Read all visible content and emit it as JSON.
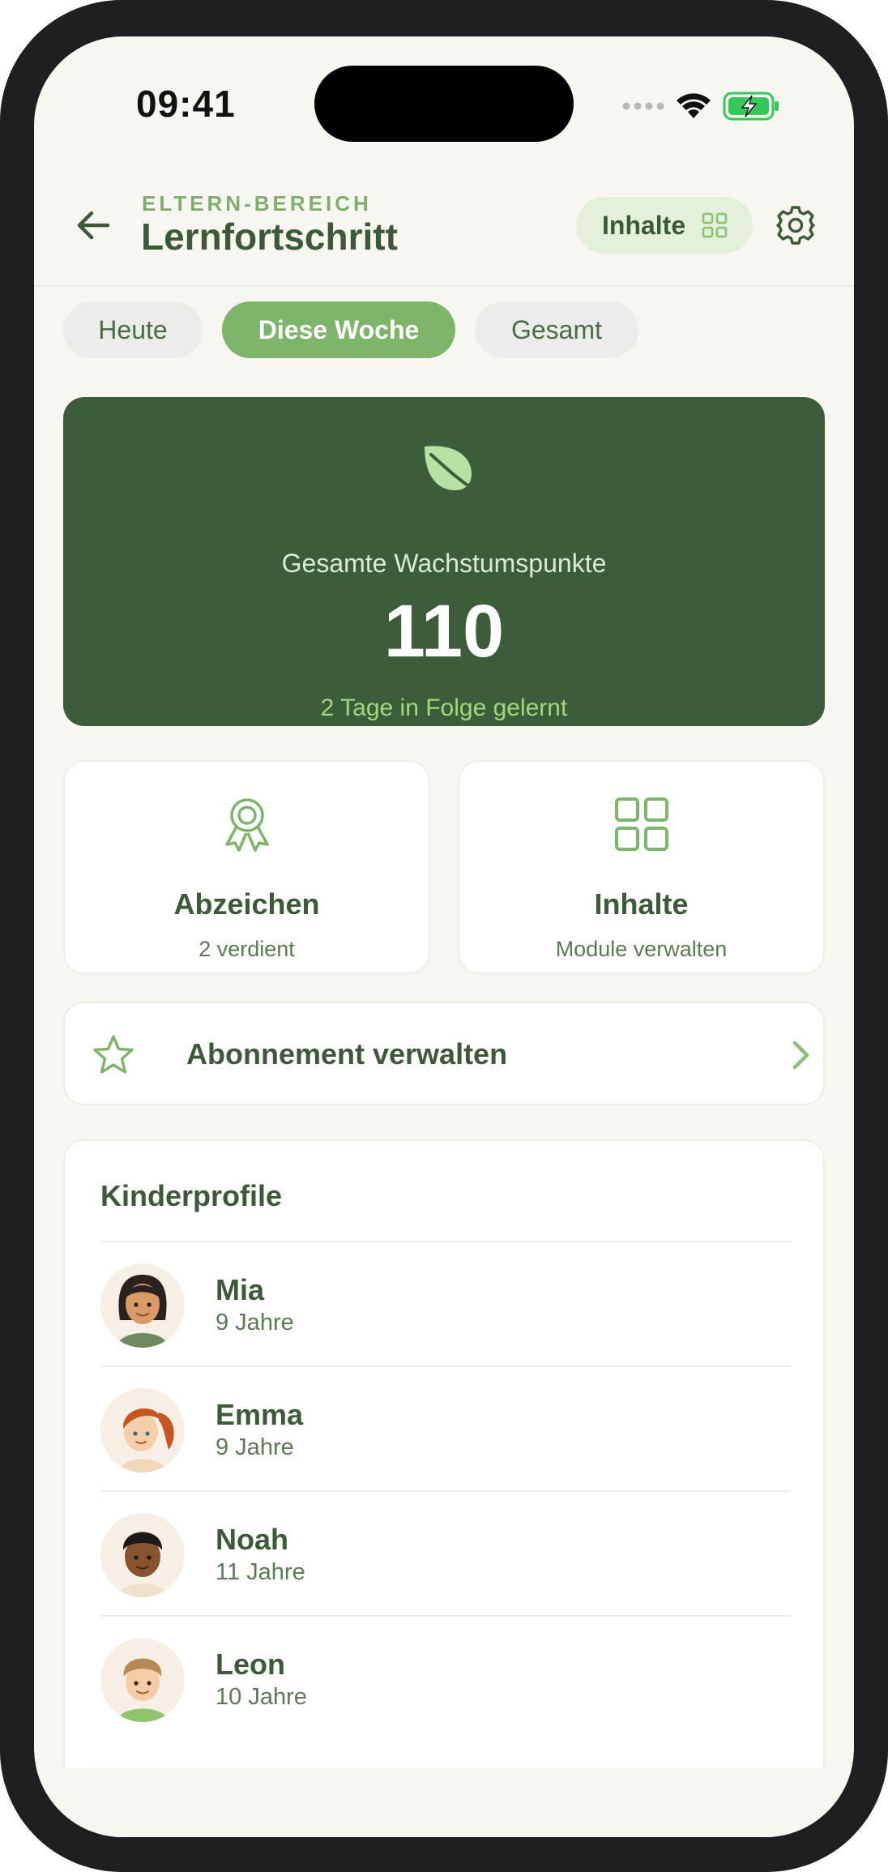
{
  "status_bar": {
    "time": "09:41"
  },
  "header": {
    "eyebrow": "ELTERN-BEREICH",
    "title": "Lernfortschritt",
    "content_button_label": "Inhalte"
  },
  "tabs": [
    {
      "label": "Heute",
      "active": false
    },
    {
      "label": "Diese Woche",
      "active": true
    },
    {
      "label": "Gesamt",
      "active": false
    }
  ],
  "hero": {
    "label": "Gesamte Wachstumspunkte",
    "value": "110",
    "streak": "2 Tage in Folge gelernt"
  },
  "cards": {
    "badges": {
      "title": "Abzeichen",
      "subtitle": "2 verdient"
    },
    "content": {
      "title": "Inhalte",
      "subtitle": "Module verwalten"
    }
  },
  "subscription": {
    "label": "Abonnement verwalten"
  },
  "profiles": {
    "title": "Kinderprofile",
    "items": [
      {
        "name": "Mia",
        "age": "9 Jahre"
      },
      {
        "name": "Emma",
        "age": "9 Jahre"
      },
      {
        "name": "Noah",
        "age": "11 Jahre"
      },
      {
        "name": "Leon",
        "age": "10 Jahre"
      }
    ]
  },
  "colors": {
    "accent": "#7db56b",
    "dark_green": "#3c5d3a",
    "text_green": "#3c5a38",
    "background": "#f8f6f1"
  }
}
